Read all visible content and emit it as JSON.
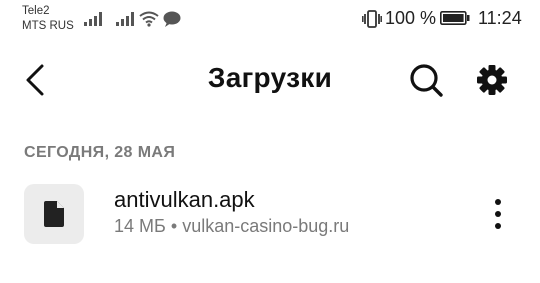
{
  "status_bar": {
    "carrier_1": "Tele2",
    "carrier_2": "MTS RUS",
    "battery_percent": "100 %",
    "time": "11:24",
    "icons": [
      "signal-icon",
      "signal-icon",
      "wifi-icon",
      "chat-bubble-icon",
      "vibrate-icon",
      "battery-icon"
    ]
  },
  "app_bar": {
    "title": "Загрузки",
    "icons": [
      "back-arrow-icon",
      "search-icon",
      "gear-icon"
    ]
  },
  "section": {
    "header": "СЕГОДНЯ, 28 МАЯ"
  },
  "downloads": [
    {
      "name": "antivulkan.apk",
      "size": "14 МБ",
      "separator": "•",
      "source": "vulkan-casino-bug.ru",
      "icon": "document-icon",
      "menu_icon": "more-vertical-icon"
    }
  ],
  "colors": {
    "text_primary": "#111111",
    "text_secondary": "#7a7a7a",
    "file_tile_bg": "#ececec",
    "background": "#ffffff"
  }
}
